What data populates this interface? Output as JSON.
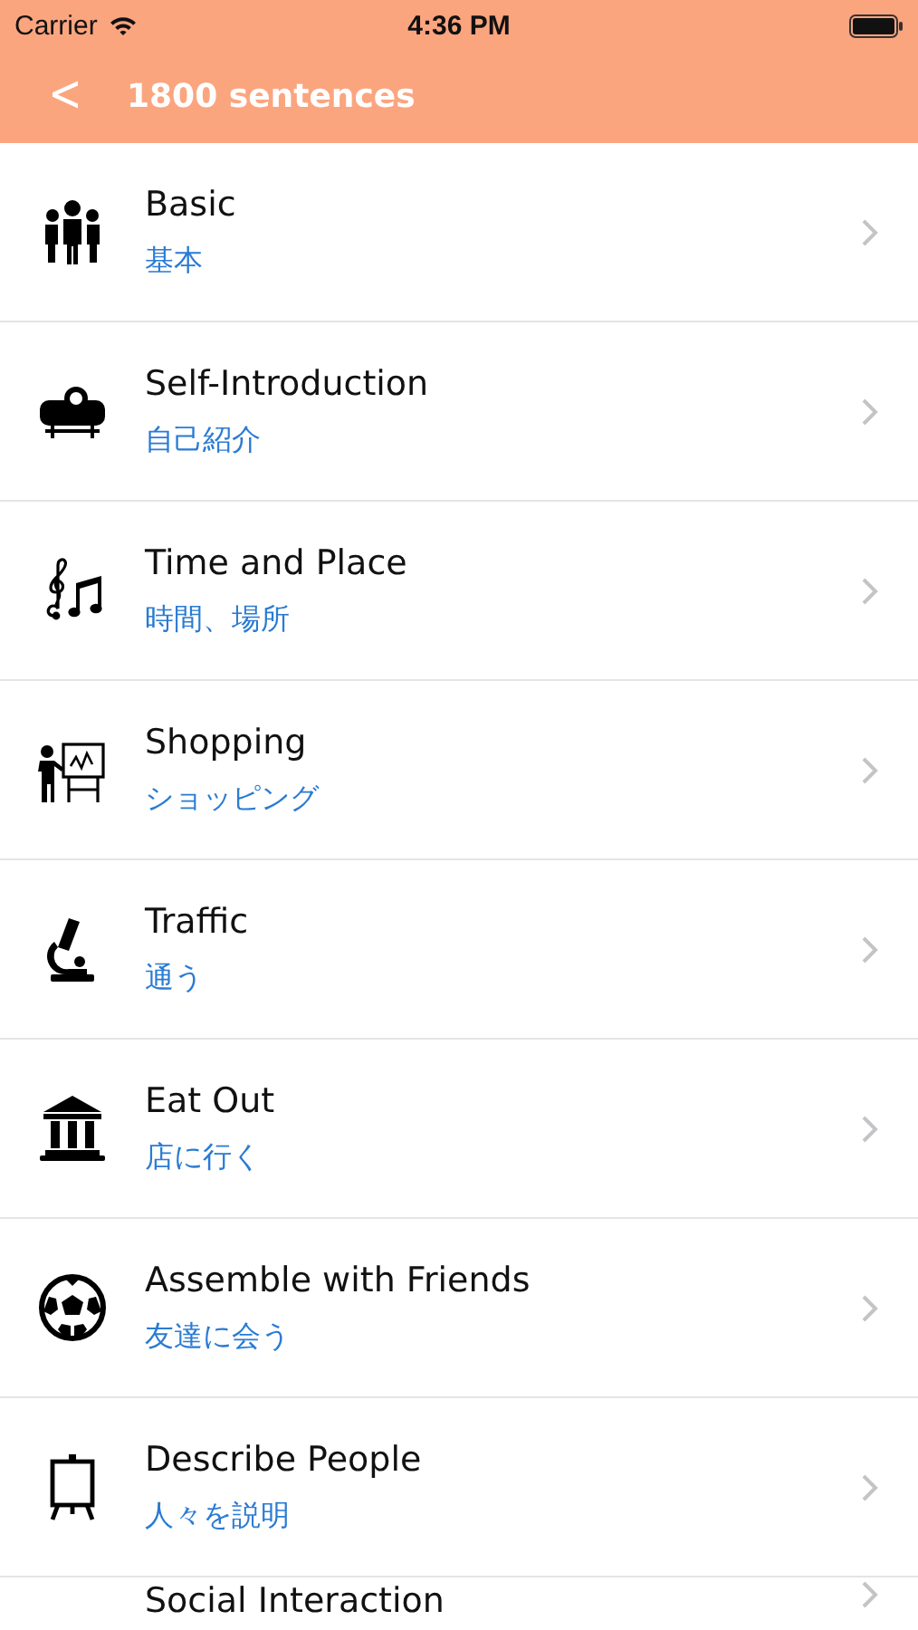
{
  "status_bar": {
    "carrier": "Carrier",
    "time": "4:36 PM"
  },
  "nav": {
    "back": "<",
    "title": "1800 sentences"
  },
  "categories": [
    {
      "title": "Basic",
      "subtitle": "基本"
    },
    {
      "title": "Self-Introduction",
      "subtitle": "自己紹介"
    },
    {
      "title": "Time and Place",
      "subtitle": "時間、場所"
    },
    {
      "title": "Shopping",
      "subtitle": "ショッピング"
    },
    {
      "title": "Traffic",
      "subtitle": "通う"
    },
    {
      "title": "Eat Out",
      "subtitle": "店に行く"
    },
    {
      "title": "Assemble with Friends",
      "subtitle": "友達に会う"
    },
    {
      "title": "Describe People",
      "subtitle": "人々を説明"
    },
    {
      "title": "Social Interaction"
    }
  ]
}
